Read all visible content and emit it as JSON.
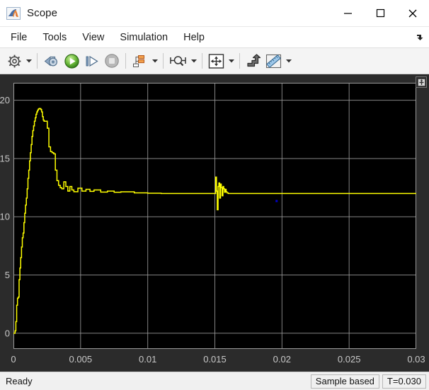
{
  "window": {
    "title": "Scope",
    "app_icon": "matlab-membrane-icon",
    "minimize_label": "Minimize",
    "maximize_label": "Maximize",
    "close_label": "Close"
  },
  "menubar": {
    "items": [
      {
        "label": "File"
      },
      {
        "label": "Tools"
      },
      {
        "label": "View"
      },
      {
        "label": "Simulation"
      },
      {
        "label": "Help"
      }
    ],
    "overflow_icon": "overflow-arrow-icon"
  },
  "toolbar": {
    "buttons": [
      {
        "name": "configuration-properties",
        "icon": "gear-icon",
        "dropdown": true
      },
      {
        "name": "separator-1",
        "icon": "separator",
        "dropdown": false
      },
      {
        "name": "rewind-to-start",
        "icon": "rewind-icon",
        "dropdown": false
      },
      {
        "name": "run",
        "icon": "play-icon",
        "dropdown": false
      },
      {
        "name": "step-forward",
        "icon": "step-forward-icon",
        "dropdown": false
      },
      {
        "name": "stop",
        "icon": "stop-icon",
        "dropdown": false
      },
      {
        "name": "separator-2",
        "icon": "separator",
        "dropdown": false
      },
      {
        "name": "signal-selection",
        "icon": "signal-blocks-icon",
        "dropdown": true
      },
      {
        "name": "separator-3",
        "icon": "separator",
        "dropdown": false
      },
      {
        "name": "zoom-in-x",
        "icon": "zoom-x-icon",
        "dropdown": true
      },
      {
        "name": "separator-4",
        "icon": "separator",
        "dropdown": false
      },
      {
        "name": "scale-axes-limits",
        "icon": "fit-to-view-icon",
        "dropdown": true
      },
      {
        "name": "separator-5",
        "icon": "separator",
        "dropdown": false
      },
      {
        "name": "autoscale",
        "icon": "autoscale-arrow-icon",
        "dropdown": false
      },
      {
        "name": "measurements",
        "icon": "ruler-icon",
        "dropdown": true
      }
    ]
  },
  "plot": {
    "maximize_axes_icon": "maximize-axes-icon",
    "background_color": "#000000",
    "grid_color": "#9a9a9a",
    "axis_label_color": "#c8c8c8",
    "panel_color": "#2b2b2b",
    "trace_color": "#ffff00",
    "marker_color": "#0000cc"
  },
  "statusbar": {
    "message": "Ready",
    "panels": [
      {
        "label": "Sample based"
      },
      {
        "label": "T=0.030"
      }
    ]
  },
  "chart_data": {
    "type": "line",
    "title": "",
    "xlabel": "",
    "ylabel": "",
    "xlim": [
      0,
      0.03
    ],
    "ylim": [
      -1.35,
      21.5
    ],
    "xticks": [
      0,
      0.005,
      0.01,
      0.015,
      0.02,
      0.025,
      0.03
    ],
    "xticklabels": [
      "0",
      "0.005",
      "0.01",
      "0.015",
      "0.02",
      "0.025",
      "0.03"
    ],
    "yticks": [
      0,
      5,
      10,
      15,
      20
    ],
    "yticklabels": [
      "0",
      "5",
      "10",
      "15",
      "20"
    ],
    "grid": true,
    "legend": false,
    "series": [
      {
        "name": "signal",
        "color": "#ffff00",
        "steps": true,
        "x": [
          0.0,
          6e-05,
          0.00012,
          0.00018,
          0.00024,
          0.0003,
          0.00036,
          0.00042,
          0.00048,
          0.00054,
          0.0006,
          0.00066,
          0.00072,
          0.00078,
          0.00084,
          0.0009,
          0.00096,
          0.00102,
          0.00108,
          0.00114,
          0.0012,
          0.00126,
          0.00132,
          0.00138,
          0.00144,
          0.0015,
          0.00156,
          0.00162,
          0.00168,
          0.00174,
          0.0018,
          0.00186,
          0.00192,
          0.00198,
          0.00204,
          0.0021,
          0.00216,
          0.00222,
          0.00228,
          0.00234,
          0.0024,
          0.00252,
          0.00264,
          0.00276,
          0.00288,
          0.003,
          0.00312,
          0.00324,
          0.00336,
          0.00348,
          0.0036,
          0.00375,
          0.0039,
          0.00405,
          0.0042,
          0.00435,
          0.0045,
          0.0048,
          0.0051,
          0.0054,
          0.0057,
          0.006,
          0.0065,
          0.007,
          0.0075,
          0.008,
          0.009,
          0.01,
          0.011,
          0.012,
          0.013,
          0.014,
          0.0146,
          0.01468,
          0.01476,
          0.01484,
          0.01492,
          0.015,
          0.01506,
          0.01512,
          0.01518,
          0.01524,
          0.0153,
          0.01536,
          0.01542,
          0.01548,
          0.01554,
          0.0156,
          0.01566,
          0.01572,
          0.01578,
          0.01584,
          0.0159,
          0.016,
          0.017,
          0.018,
          0.019,
          0.02,
          0.021,
          0.022,
          0.023,
          0.024,
          0.025,
          0.026,
          0.027,
          0.028,
          0.029,
          0.03
        ],
        "y": [
          0.0,
          0.0,
          0.2,
          1.0,
          2.4,
          3.0,
          3.1,
          4.6,
          5.6,
          6.5,
          7.4,
          8.2,
          8.6,
          9.5,
          10.3,
          11.0,
          11.6,
          12.4,
          13.3,
          14.0,
          14.8,
          15.5,
          16.2,
          16.9,
          17.4,
          17.8,
          18.2,
          18.5,
          18.8,
          19.0,
          19.15,
          19.25,
          19.3,
          19.28,
          19.2,
          19.0,
          18.6,
          18.3,
          18.2,
          18.2,
          18.2,
          17.6,
          16.0,
          15.6,
          15.5,
          15.4,
          14.0,
          13.1,
          12.7,
          12.5,
          12.4,
          13.0,
          12.6,
          12.2,
          12.6,
          12.3,
          12.15,
          12.45,
          12.2,
          12.35,
          12.18,
          12.3,
          12.12,
          12.2,
          12.1,
          12.14,
          12.05,
          12.02,
          12.0,
          12.0,
          12.0,
          12.0,
          12.0,
          12.0,
          12.0,
          12.0,
          12.0,
          12.0,
          13.4,
          12.2,
          10.6,
          12.6,
          12.9,
          11.6,
          12.8,
          12.5,
          11.8,
          12.6,
          12.4,
          12.1,
          12.35,
          12.15,
          12.05,
          12.0,
          12.0,
          12.0,
          12.0,
          12.0,
          12.0,
          12.0,
          12.0,
          12.0,
          12.0,
          12.0,
          12.0,
          12.0,
          12.0,
          12.0,
          12.0
        ]
      }
    ],
    "markers": [
      {
        "name": "cursor-dot",
        "x": 0.0196,
        "y": 11.35,
        "color": "#0000cc"
      }
    ]
  }
}
